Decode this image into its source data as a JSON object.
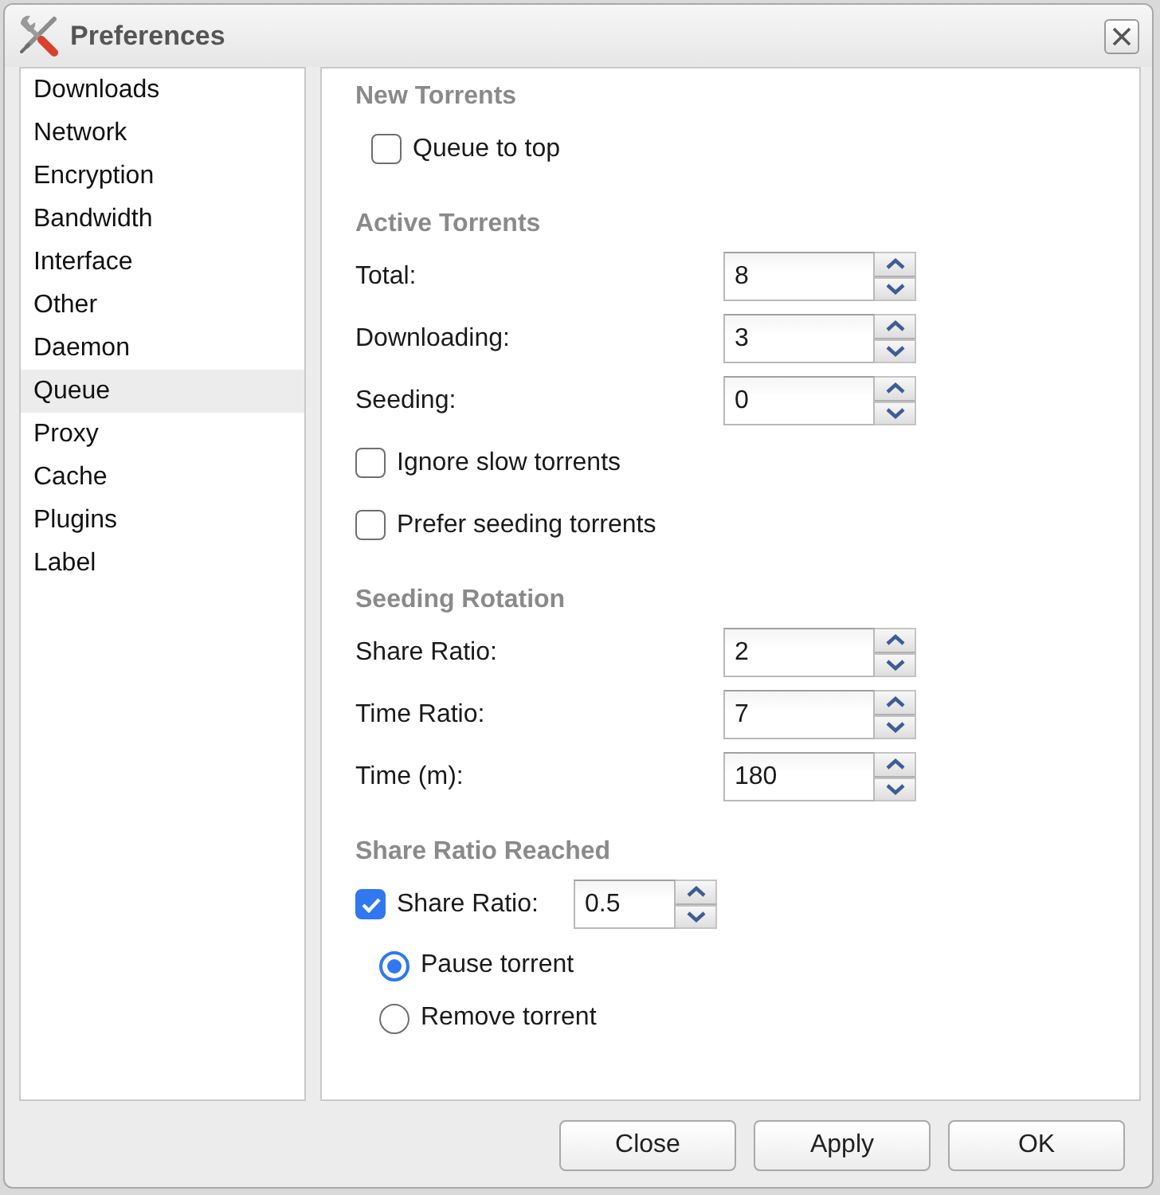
{
  "window": {
    "title": "Preferences"
  },
  "sidebar": {
    "items": [
      {
        "label": "Downloads",
        "selected": false
      },
      {
        "label": "Network",
        "selected": false
      },
      {
        "label": "Encryption",
        "selected": false
      },
      {
        "label": "Bandwidth",
        "selected": false
      },
      {
        "label": "Interface",
        "selected": false
      },
      {
        "label": "Other",
        "selected": false
      },
      {
        "label": "Daemon",
        "selected": false
      },
      {
        "label": "Queue",
        "selected": true
      },
      {
        "label": "Proxy",
        "selected": false
      },
      {
        "label": "Cache",
        "selected": false
      },
      {
        "label": "Plugins",
        "selected": false
      },
      {
        "label": "Label",
        "selected": false
      }
    ]
  },
  "sections": [
    {
      "heading": "New Torrents",
      "rows": [
        {
          "kind": "checkbox",
          "label": "Queue to top",
          "checked": false
        }
      ]
    },
    {
      "heading": "Active Torrents",
      "rows": [
        {
          "kind": "spinner",
          "label": "Total:",
          "value": "8"
        },
        {
          "kind": "spinner",
          "label": "Downloading:",
          "value": "3"
        },
        {
          "kind": "spinner",
          "label": "Seeding:",
          "value": "0"
        },
        {
          "kind": "checkbox",
          "label": "Ignore slow torrents",
          "checked": false
        },
        {
          "kind": "checkbox",
          "label": "Prefer seeding torrents",
          "checked": false
        }
      ]
    },
    {
      "heading": "Seeding Rotation",
      "rows": [
        {
          "kind": "spinner",
          "label": "Share Ratio:",
          "value": "2"
        },
        {
          "kind": "spinner",
          "label": "Time Ratio:",
          "value": "7"
        },
        {
          "kind": "spinner",
          "label": "Time (m):",
          "value": "180"
        }
      ]
    },
    {
      "heading": "Share Ratio Reached",
      "rows": [
        {
          "kind": "checkspinner",
          "label": "Share Ratio:",
          "checked": true,
          "value": "0.5"
        },
        {
          "kind": "radio",
          "label": "Pause torrent",
          "selected": true
        },
        {
          "kind": "radio",
          "label": "Remove torrent",
          "selected": false
        }
      ]
    }
  ],
  "buttons": [
    "Close",
    "Apply",
    "OK"
  ]
}
